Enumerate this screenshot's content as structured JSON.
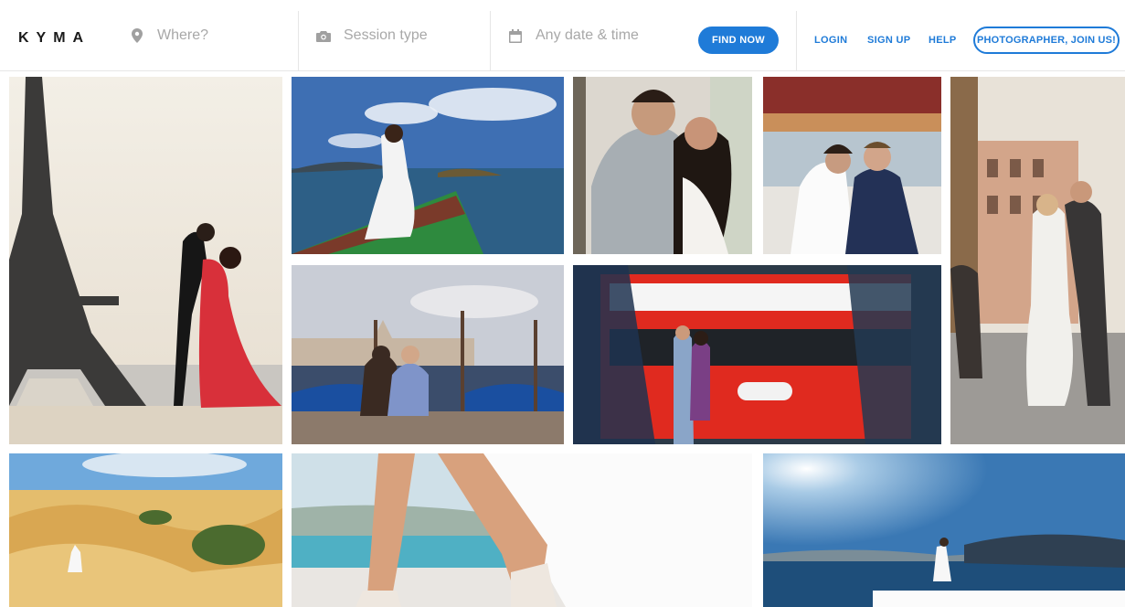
{
  "brand": {
    "logo": "KYMA",
    "accent": "#1f7bd8"
  },
  "search": {
    "where_placeholder": "Where?",
    "session_placeholder": "Session type",
    "date_placeholder": "Any date & time",
    "find_label": "FIND NOW"
  },
  "nav": {
    "login": "LOGIN",
    "signup": "SIGN UP",
    "help": "HELP",
    "join": "PHOTOGRAPHER, JOIN US!"
  },
  "icons": {
    "where": "map-pin-icon",
    "session": "camera-icon",
    "date": "calendar-icon"
  },
  "gallery": {
    "photos": [
      "eiffel-tower-couple",
      "bride-on-boat",
      "couple-embrace",
      "couple-in-carriage",
      "rome-street-couple",
      "venice-gondolas-couple",
      "london-red-bus-couple",
      "desert-dunes-couple",
      "bride-heels-walking",
      "santorini-couple"
    ]
  }
}
